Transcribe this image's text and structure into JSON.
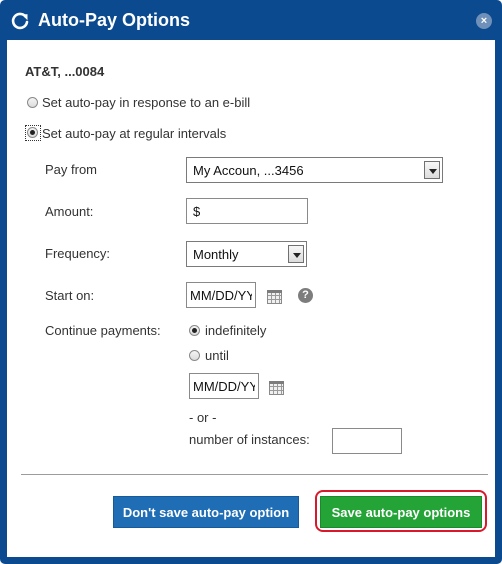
{
  "dialog": {
    "title": "Auto-Pay Options",
    "close_label": "×"
  },
  "account": {
    "name": "AT&T, ...0084"
  },
  "autopay_modes": [
    {
      "label": "Set auto-pay in response to an e-bill",
      "selected": false
    },
    {
      "label": "Set auto-pay at regular intervals",
      "selected": true
    }
  ],
  "form": {
    "pay_from": {
      "label": "Pay from",
      "value": "My Accoun, ...3456"
    },
    "amount": {
      "label": "Amount:",
      "value": "$"
    },
    "frequency": {
      "label": "Frequency:",
      "value": "Monthly"
    },
    "start_on": {
      "label": "Start on:",
      "placeholder": "MM/DD/YY",
      "help": "?"
    },
    "continue": {
      "label": "Continue payments:",
      "options": [
        {
          "label": "indefinitely",
          "selected": true
        },
        {
          "label": "until",
          "selected": false
        }
      ],
      "until_placeholder": "MM/DD/YY",
      "or_text": "- or -",
      "instances_label": "number of instances:",
      "instances_value": ""
    }
  },
  "buttons": {
    "dont_save": "Don't save auto-pay option",
    "save": "Save auto-pay options"
  },
  "colors": {
    "frame": "#0b4a8f",
    "primary_button": "#1f6db4",
    "save_button": "#24a337",
    "highlight_ring": "#d8192c"
  },
  "icons": {
    "title": "refresh-icon",
    "close": "close-icon",
    "calendar": "calendar-icon",
    "help": "help-icon"
  }
}
